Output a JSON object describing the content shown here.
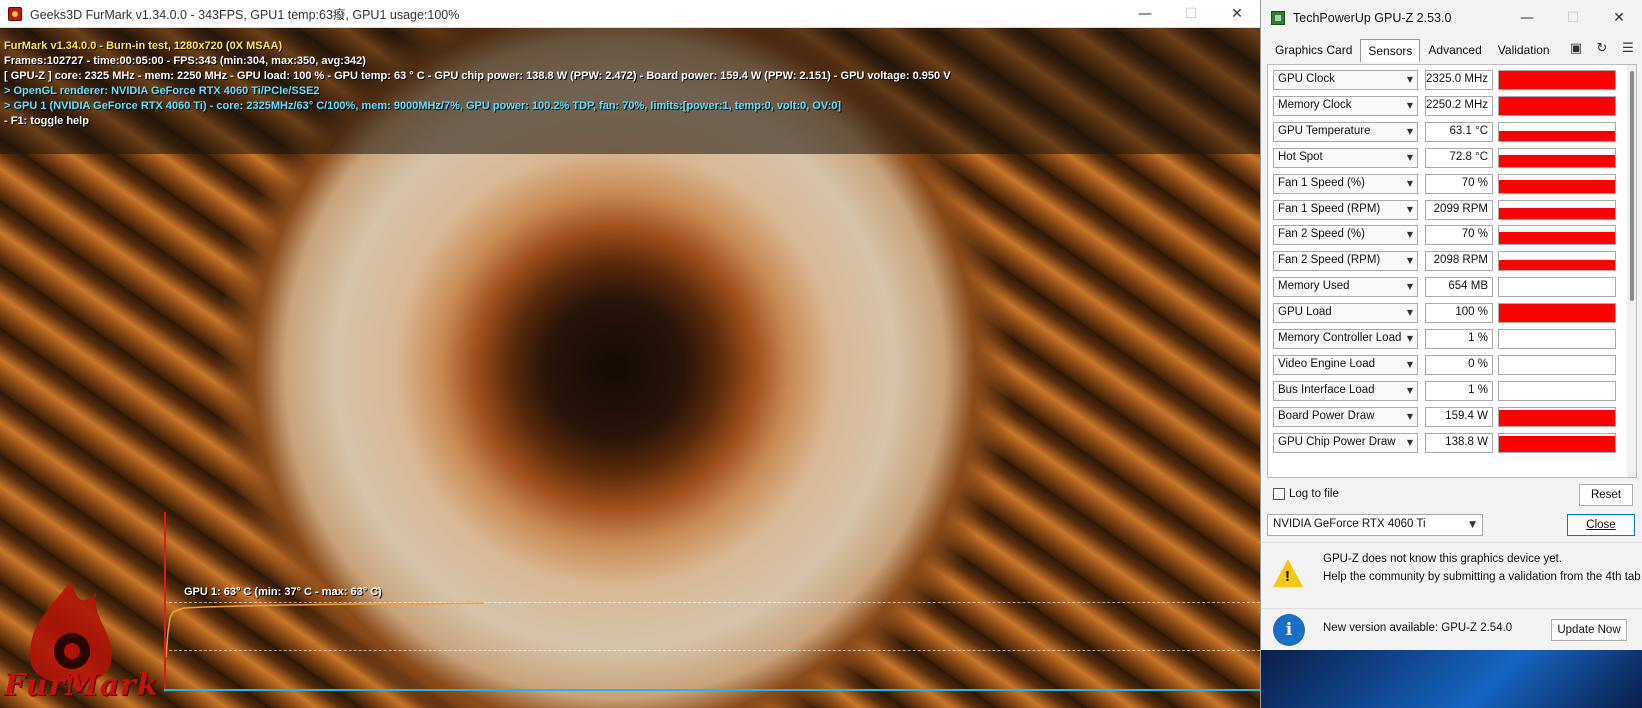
{
  "furmark": {
    "window_title": "Geeks3D FurMark v1.34.0.0 - 343FPS, GPU1 temp:63癈, GPU1 usage:100%",
    "overlay": {
      "line1": "FurMark v1.34.0.0 - Burn-in test, 1280x720 (0X MSAA)",
      "line2": "Frames:102727 - time:00:05:00 - FPS:343 (min:304, max:350, avg:342)",
      "line3": "[ GPU-Z ] core: 2325 MHz - mem: 2250 MHz - GPU load: 100 % - GPU temp: 63 ° C - GPU chip power: 138.8 W (PPW: 2.472) - Board power: 159.4 W (PPW: 2.151) - GPU voltage: 0.950 V",
      "line4": "> OpenGL renderer: NVIDIA GeForce RTX 4060 Ti/PCIe/SSE2",
      "line5": "> GPU 1 (NVIDIA GeForce RTX 4060 Ti) - core: 2325MHz/63° C/100%, mem: 9000MHz/7%, GPU power: 100.2% TDP, fan: 70%, limits:[power:1, temp:0, volt:0, OV:0]",
      "line6": "- F1: toggle help"
    },
    "graph": {
      "label": "GPU 1: 63° C (min: 37° C - max: 63° C)",
      "line_color": "#f0a030"
    },
    "logo_text": "FurMark"
  },
  "gpuz": {
    "window_title": "TechPowerUp GPU-Z 2.53.0",
    "tabs": [
      {
        "label": "Graphics Card"
      },
      {
        "label": "Sensors"
      },
      {
        "label": "Advanced"
      },
      {
        "label": "Validation"
      }
    ],
    "toolbar_icons": [
      "camera-icon",
      "refresh-icon",
      "menu-icon"
    ],
    "sensors": [
      {
        "name": "GPU Clock",
        "value": "2325.0 MHz",
        "level": 1.0
      },
      {
        "name": "Memory Clock",
        "value": "2250.2 MHz",
        "level": 1.0
      },
      {
        "name": "GPU Temperature",
        "value": "63.1 °C",
        "level": 0.55
      },
      {
        "name": "Hot Spot",
        "value": "72.8 °C",
        "level": 0.65
      },
      {
        "name": "Fan 1 Speed (%)",
        "value": "70 %",
        "level": 0.7
      },
      {
        "name": "Fan 1 Speed (RPM)",
        "value": "2099 RPM",
        "level": 0.6
      },
      {
        "name": "Fan 2 Speed (%)",
        "value": "70 %",
        "level": 0.7
      },
      {
        "name": "Fan 2 Speed (RPM)",
        "value": "2098 RPM",
        "level": 0.6
      },
      {
        "name": "Memory Used",
        "value": "654 MB",
        "level": 0.0
      },
      {
        "name": "GPU Load",
        "value": "100 %",
        "level": 1.0
      },
      {
        "name": "Memory Controller Load",
        "value": "1 %",
        "level": 0.0
      },
      {
        "name": "Video Engine Load",
        "value": "0 %",
        "level": 0.0
      },
      {
        "name": "Bus Interface Load",
        "value": "1 %",
        "level": 0.0
      },
      {
        "name": "Board Power Draw",
        "value": "159.4 W",
        "level": 0.85
      },
      {
        "name": "GPU Chip Power Draw",
        "value": "138.8 W",
        "level": 0.85
      }
    ],
    "log_label": "Log to file",
    "reset_label": "Reset",
    "device": "NVIDIA GeForce RTX 4060 Ti",
    "close_label": "Close",
    "notice_warning_line1": "GPU-Z does not know this graphics device yet.",
    "notice_warning_line2": "Help the community by submitting a validation from the 4th tab.",
    "notice_update": "New version available: GPU-Z 2.54.0",
    "update_label": "Update Now",
    "graph_color": "#ff0000"
  }
}
